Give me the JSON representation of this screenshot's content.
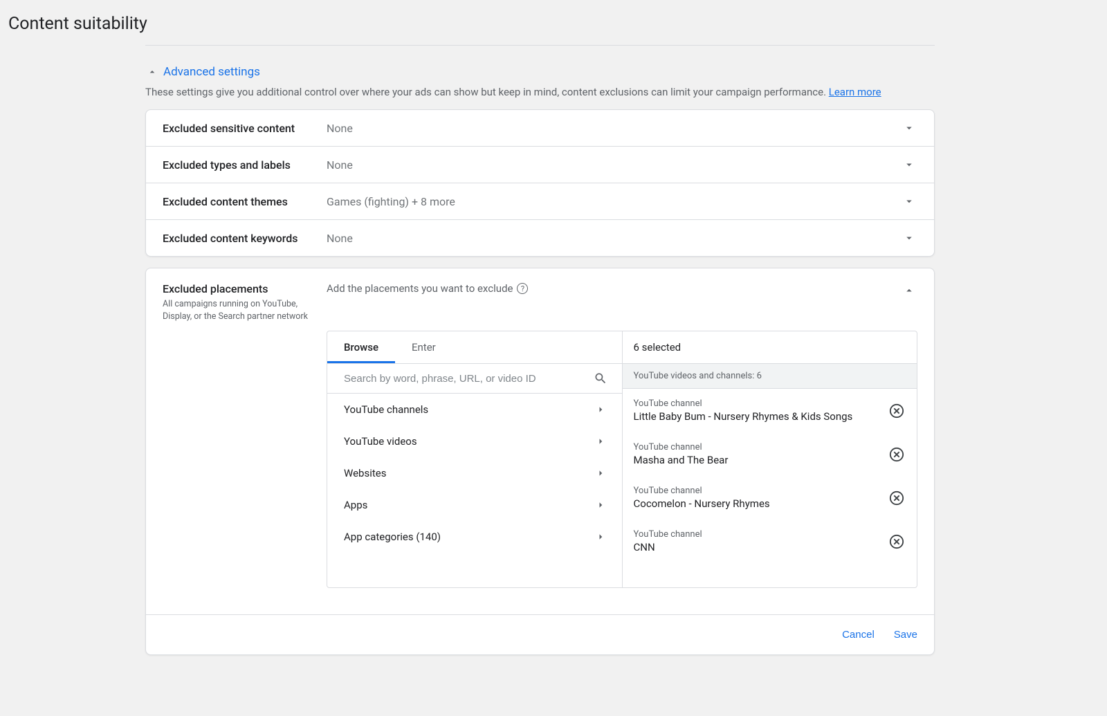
{
  "page": {
    "title": "Content suitability"
  },
  "advanced": {
    "toggle_label": "Advanced settings",
    "description": "These settings give you additional control over where your ads can show but keep in mind, content exclusions can limit your campaign performance. ",
    "learn_more": "Learn more"
  },
  "settings": {
    "sensitive": {
      "label": "Excluded sensitive content",
      "value": "None"
    },
    "types": {
      "label": "Excluded types and labels",
      "value": "None"
    },
    "themes": {
      "label": "Excluded content themes",
      "value": "Games (fighting) + 8 more"
    },
    "keywords": {
      "label": "Excluded content keywords",
      "value": "None"
    }
  },
  "placements": {
    "title": "Excluded placements",
    "subtitle": "All campaigns running on YouTube, Display, or the Search partner network",
    "prompt": "Add the placements you want to exclude",
    "tabs": {
      "browse": "Browse",
      "enter": "Enter"
    },
    "search_placeholder": "Search by word, phrase, URL, or video ID",
    "browse_items": {
      "channels": "YouTube channels",
      "videos": "YouTube videos",
      "websites": "Websites",
      "apps": "Apps",
      "appcats": "App categories (140)"
    },
    "selected_count_label": "6 selected",
    "selected_group_label": "YouTube videos and channels: 6",
    "selected": [
      {
        "type": "YouTube channel",
        "name": "Little Baby Bum - Nursery Rhymes & Kids Songs"
      },
      {
        "type": "YouTube channel",
        "name": "Masha and The Bear"
      },
      {
        "type": "YouTube channel",
        "name": "Cocomelon - Nursery Rhymes"
      },
      {
        "type": "YouTube channel",
        "name": "CNN"
      }
    ]
  },
  "footer": {
    "cancel": "Cancel",
    "save": "Save"
  }
}
